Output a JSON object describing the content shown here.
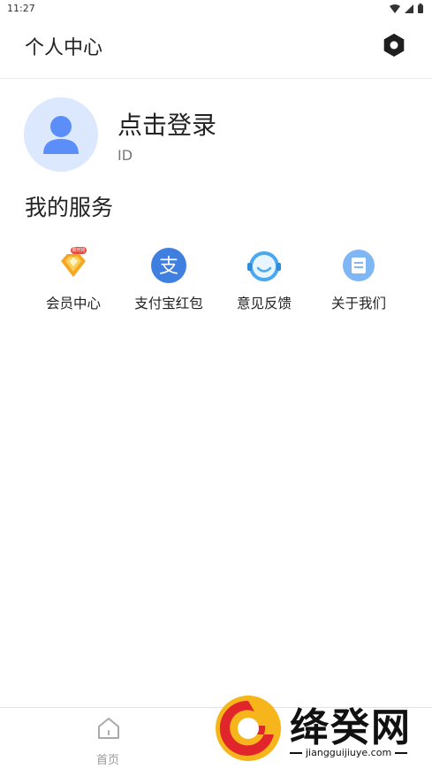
{
  "status_bar": {
    "time": "11:27"
  },
  "header": {
    "title": "个人中心"
  },
  "profile": {
    "login_label": "点击登录",
    "id_label": "ID"
  },
  "services": {
    "title": "我的服务",
    "items": [
      {
        "label": "会员中心",
        "icon": "vip-diamond-icon",
        "badge": "限时抢"
      },
      {
        "label": "支付宝红包",
        "icon": "alipay-icon"
      },
      {
        "label": "意见反馈",
        "icon": "customer-service-icon"
      },
      {
        "label": "关于我们",
        "icon": "document-icon"
      }
    ]
  },
  "bottom_nav": {
    "items": [
      {
        "label": "首页",
        "icon": "home-icon"
      }
    ]
  },
  "watermark": {
    "name": "绛癸网",
    "url": "jiangguijiuye.com"
  },
  "colors": {
    "accent_blue": "#5b8ef8",
    "avatar_bg": "#dbe8fd",
    "alipay_blue": "#3f7fe0",
    "feedback_blue": "#4aa8f0",
    "vip_orange": "#f5a623",
    "watermark_red": "#e0262b",
    "watermark_orange": "#f6b51b"
  }
}
